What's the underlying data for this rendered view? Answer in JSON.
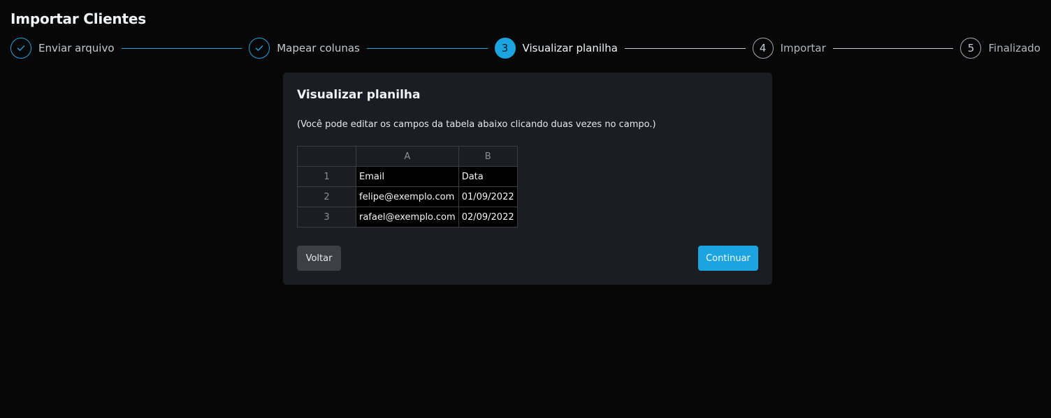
{
  "page": {
    "title": "Importar Clientes"
  },
  "stepper": {
    "steps": [
      {
        "number": "1",
        "label": "Enviar arquivo",
        "state": "done",
        "icon": "check-icon"
      },
      {
        "number": "2",
        "label": "Mapear colunas",
        "state": "done",
        "icon": "check-icon"
      },
      {
        "number": "3",
        "label": "Visualizar planilha",
        "state": "active"
      },
      {
        "number": "4",
        "label": "Importar",
        "state": "pending"
      },
      {
        "number": "5",
        "label": "Finalizado",
        "state": "pending"
      }
    ]
  },
  "card": {
    "title": "Visualizar planilha",
    "hint": "(Você pode editar os campos da tabela abaixo clicando duas vezes no campo.)",
    "sheet": {
      "columns": [
        "A",
        "B"
      ],
      "rows": [
        {
          "num": "1",
          "cells": [
            "Email",
            "Data"
          ]
        },
        {
          "num": "2",
          "cells": [
            "felipe@exemplo.com",
            "01/09/2022"
          ]
        },
        {
          "num": "3",
          "cells": [
            "rafael@exemplo.com",
            "02/09/2022"
          ]
        }
      ]
    },
    "back_label": "Voltar",
    "next_label": "Continuar"
  },
  "colors": {
    "accent": "#1ca4e0",
    "card_bg": "#1a1d22",
    "page_bg": "#070707"
  }
}
